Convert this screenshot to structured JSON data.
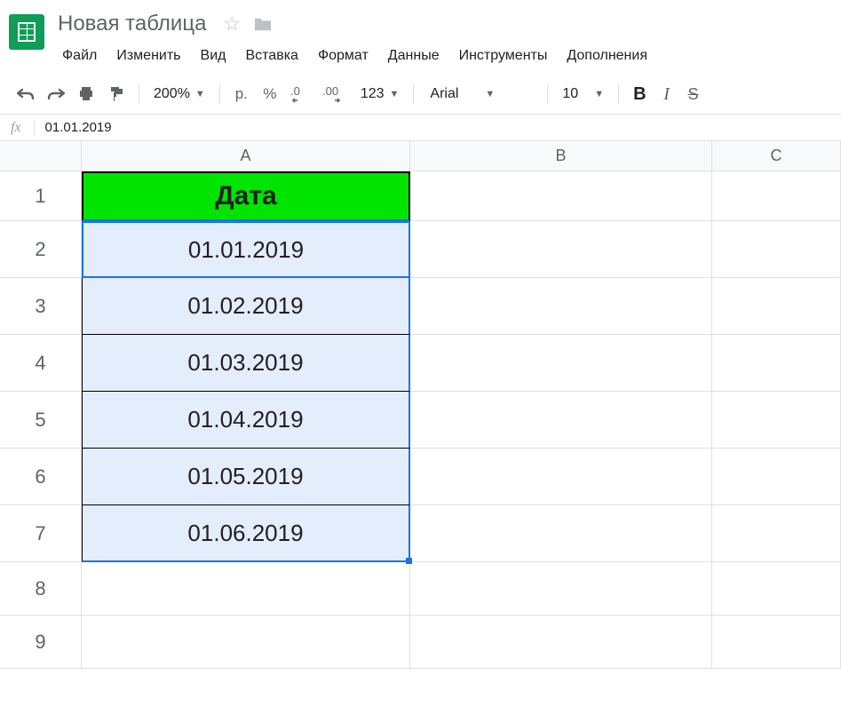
{
  "document": {
    "title": "Новая таблица"
  },
  "menubar": {
    "items": [
      "Файл",
      "Изменить",
      "Вид",
      "Вставка",
      "Формат",
      "Данные",
      "Инструменты",
      "Дополнения"
    ]
  },
  "toolbar": {
    "zoom": "200%",
    "currency_label": "р.",
    "percent_label": "%",
    "dec_decrease": ".0",
    "dec_increase": ".00",
    "more_formats": "123",
    "font": "Arial",
    "font_size": "10"
  },
  "formula_bar": {
    "value": "01.01.2019"
  },
  "grid": {
    "columns": [
      "A",
      "B",
      "C"
    ],
    "rows": [
      "1",
      "2",
      "3",
      "4",
      "5",
      "6",
      "7",
      "8",
      "9"
    ],
    "header_cell": "Дата",
    "data": [
      "01.01.2019",
      "01.02.2019",
      "01.03.2019",
      "01.04.2019",
      "01.05.2019",
      "01.06.2019"
    ],
    "active_cell": "A2",
    "selection": "A2:A7"
  },
  "colors": {
    "header_fill": "#00e400",
    "selection_fill": "#e3edfb",
    "accent": "#1a73e8"
  }
}
